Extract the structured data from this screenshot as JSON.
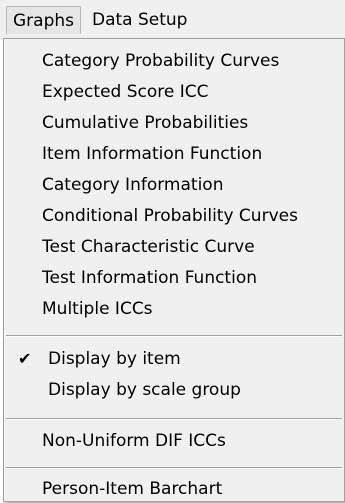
{
  "menubar": {
    "items": [
      {
        "label": "Graphs",
        "mnemonic": "G"
      },
      {
        "label": "Data Setup",
        "mnemonic": "u"
      }
    ]
  },
  "menu": {
    "graph_items": [
      {
        "label": "Category Probability Curves",
        "mnemonic": "P"
      },
      {
        "label": "Expected Score ICC",
        "mnemonic": "E"
      },
      {
        "label": "Cumulative Probabilities",
        "mnemonic": "u"
      },
      {
        "label": "Item Information Function",
        "mnemonic": "I"
      },
      {
        "label": "Category Information",
        "mnemonic": "C"
      },
      {
        "label": "Conditional Probability Curves",
        "mnemonic": "o"
      },
      {
        "label": "Test Characteristic Curve",
        "mnemonic": "T"
      },
      {
        "label": "Test Information Function",
        "mnemonic": "F"
      },
      {
        "label": "Multiple ICCs",
        "mnemonic": "M"
      }
    ],
    "display_items": [
      {
        "label": "Display by item",
        "checked": true
      },
      {
        "label": "Display by scale group",
        "checked": false
      }
    ],
    "dif_items": [
      {
        "label": "Non-Uniform DIF ICCs",
        "mnemonic": "D"
      }
    ],
    "barchart_items": [
      {
        "label": "Person-Item Barchart"
      }
    ]
  },
  "check_glyph": "✔",
  "colors": {
    "menu_bg": "#f0f0f0",
    "separator": "#a0a0a0"
  }
}
